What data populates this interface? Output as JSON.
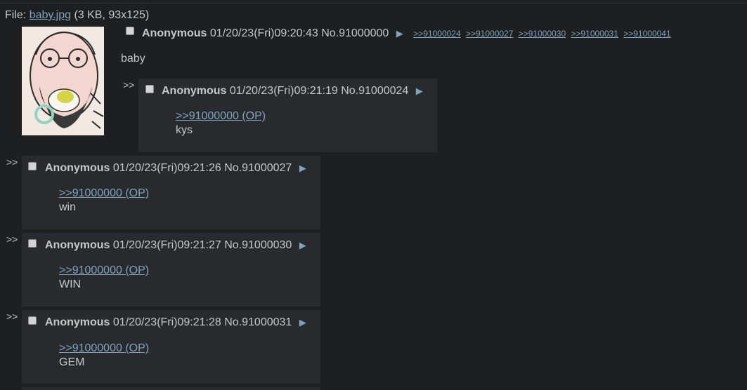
{
  "op": {
    "file_label": "File:",
    "file_name": "baby.jpg",
    "file_meta": "(3 KB, 93x125)",
    "name": "Anonymous",
    "datetime": "01/20/23(Fri)09:20:43",
    "post_no": "No.91000000",
    "backlinks": [
      ">>91000024",
      ">>91000027",
      ">>91000030",
      ">>91000031",
      ">>91000041"
    ],
    "message": "baby"
  },
  "replies": [
    {
      "name": "Anonymous",
      "datetime": "01/20/23(Fri)09:21:19",
      "post_no": "No.91000024",
      "quote": ">>91000000 (OP)",
      "message": "kys"
    },
    {
      "name": "Anonymous",
      "datetime": "01/20/23(Fri)09:21:26",
      "post_no": "No.91000027",
      "quote": ">>91000000 (OP)",
      "message": "win"
    },
    {
      "name": "Anonymous",
      "datetime": "01/20/23(Fri)09:21:27",
      "post_no": "No.91000030",
      "quote": ">>91000000 (OP)",
      "message": "WIN"
    },
    {
      "name": "Anonymous",
      "datetime": "01/20/23(Fri)09:21:28",
      "post_no": "No.91000031",
      "quote": ">>91000000 (OP)",
      "message": "GEM"
    }
  ],
  "side_arrow": ">>",
  "post_menu_icon": "triangle-right-icon",
  "colors": {
    "background": "#1d1f21",
    "reply_background": "#282a2e",
    "link": "#81a2be",
    "text": "#c5c8c6"
  }
}
